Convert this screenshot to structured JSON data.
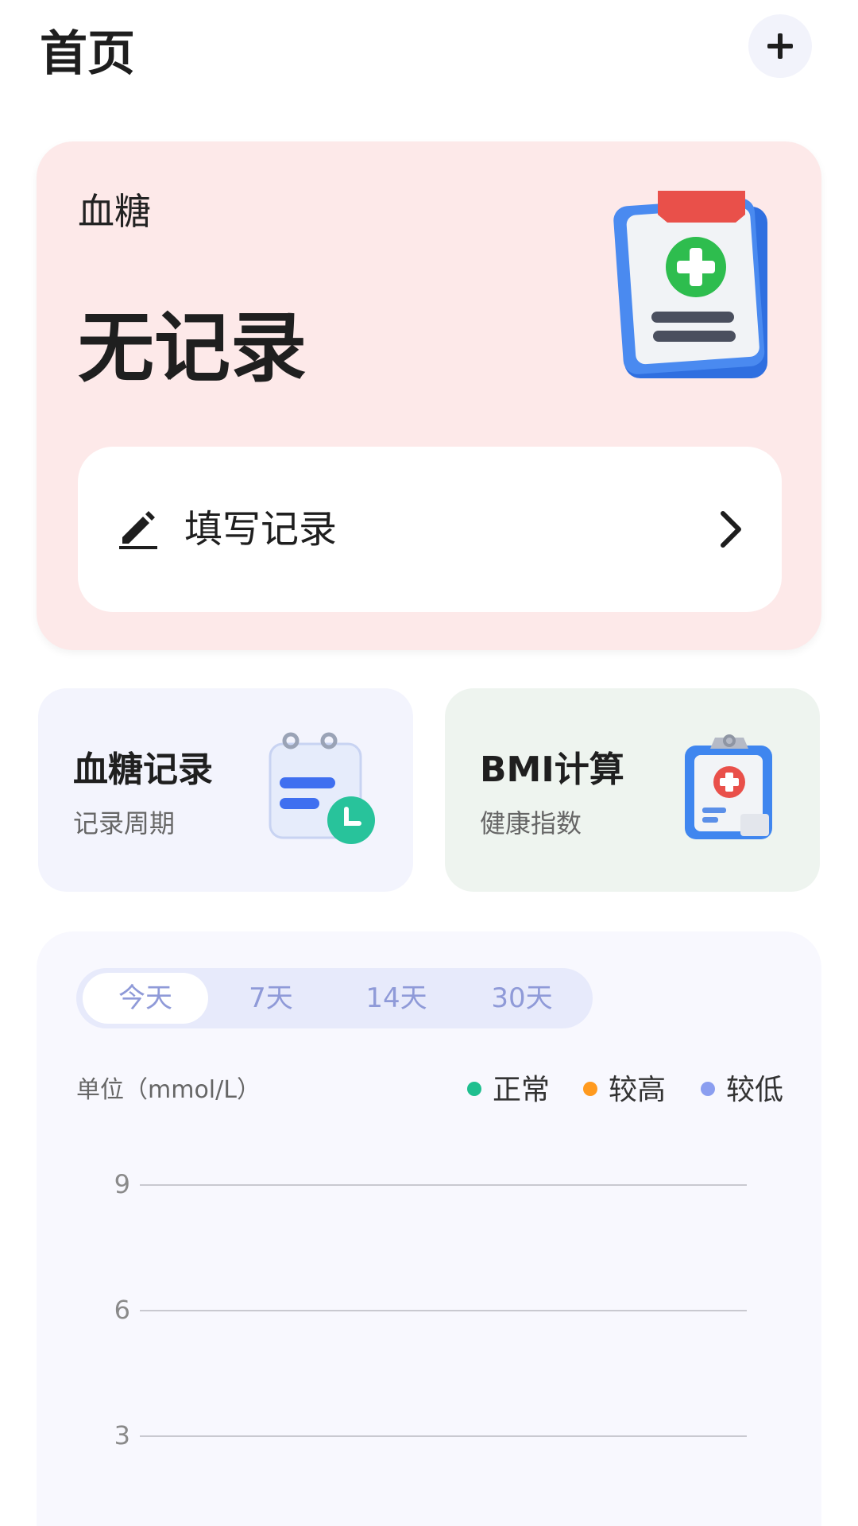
{
  "header": {
    "title": "首页",
    "add_icon": "plus-icon"
  },
  "hero": {
    "label": "血糖",
    "value": "无记录",
    "art_icon": "clipboard-medical-icon",
    "record_button": {
      "icon": "pencil-icon",
      "label": "填写记录",
      "chevron": "chevron-right-icon"
    },
    "background": "#fde9e9"
  },
  "features": [
    {
      "title": "血糖记录",
      "subtitle": "记录周期",
      "icon": "calendar-clock-icon",
      "background": "#f3f4fd"
    },
    {
      "title": "BMI计算",
      "subtitle": "健康指数",
      "icon": "medical-clipboard-icon",
      "background": "#eef4ef"
    }
  ],
  "chart": {
    "tabs": [
      "今天",
      "7天",
      "14天",
      "30天"
    ],
    "active_tab": 0,
    "unit": "单位（mmol/L）",
    "legend": [
      {
        "label": "正常",
        "color": "#1fbf8f"
      },
      {
        "label": "较高",
        "color": "#ff9a1f"
      },
      {
        "label": "较低",
        "color": "#8b9ef0"
      }
    ]
  },
  "chart_data": {
    "type": "line",
    "x": [],
    "series": [],
    "yticks": [
      "9",
      "6",
      "3"
    ],
    "ylabel": "单位（mmol/L）",
    "grid": true,
    "legend_placement": "top-right"
  }
}
